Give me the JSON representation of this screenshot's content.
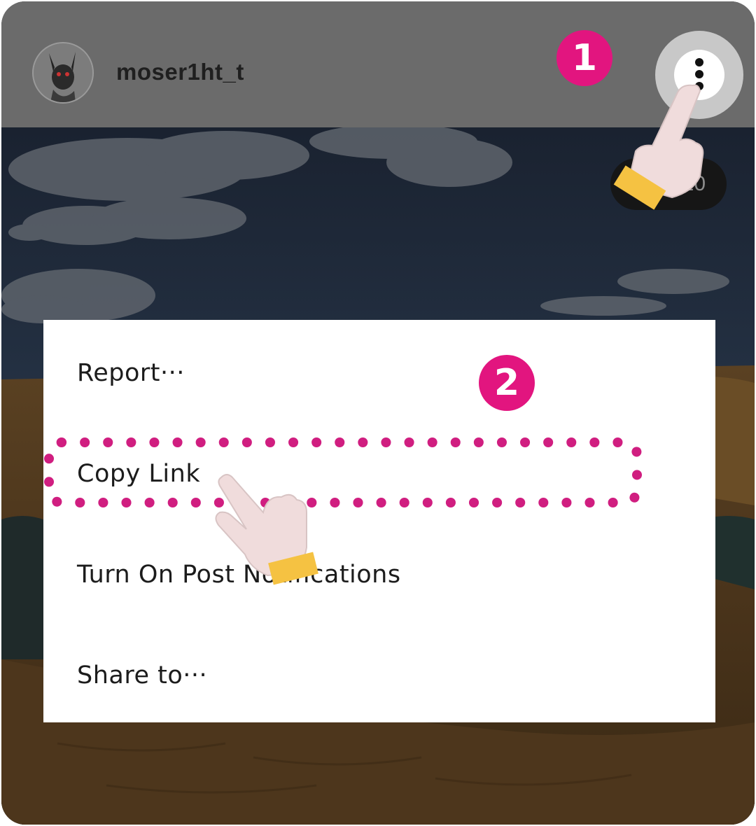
{
  "header": {
    "username": "moser1ht_t"
  },
  "counter_text": "1/10",
  "steps": {
    "step1": "1",
    "step2": "2"
  },
  "menu": {
    "items": [
      {
        "label": "Report···"
      },
      {
        "label": "Copy Link"
      },
      {
        "label": "Turn On Post Notifications"
      },
      {
        "label": "Share to···"
      }
    ]
  },
  "colors": {
    "accent": "#e2157f",
    "hand": "#f0dcdc",
    "cuff": "#f5c242",
    "header_bg": "#6b6b6b"
  },
  "icons": {
    "more": "more-vertical-icon",
    "pointer": "pointing-hand-icon"
  }
}
